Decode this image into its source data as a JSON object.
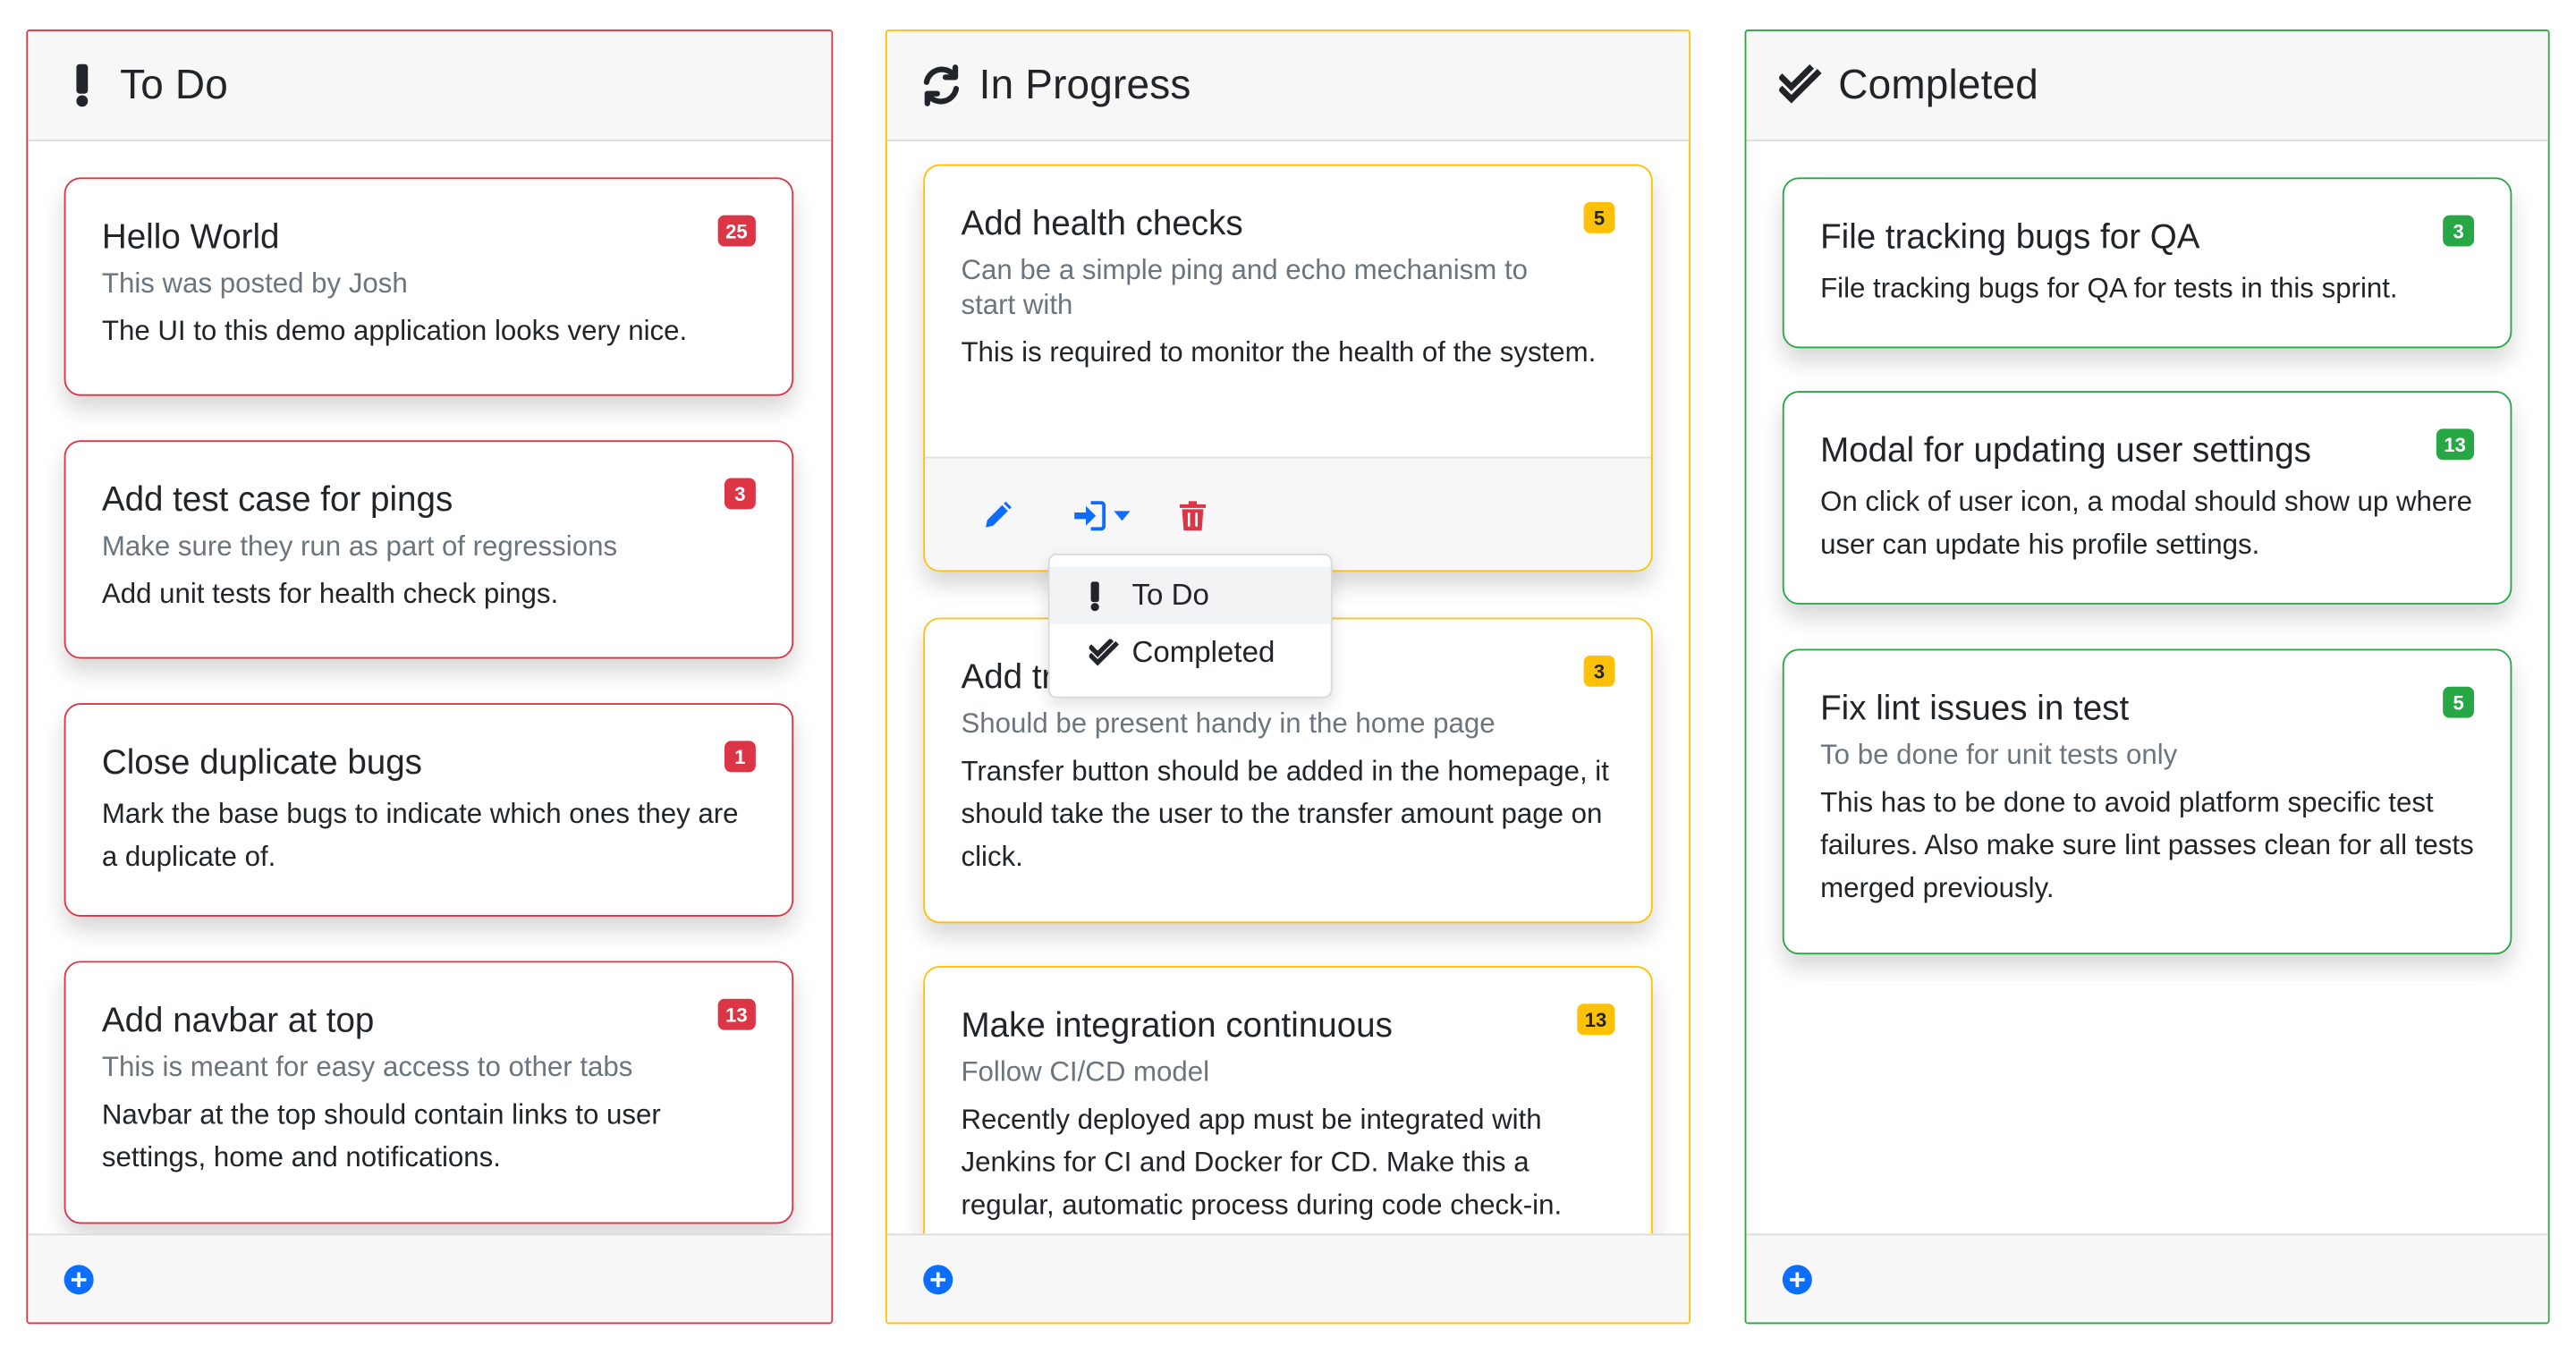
{
  "colors": {
    "todo": "#dc3545",
    "in_progress": "#ffc107",
    "completed": "#28a745",
    "primary": "#0d6efd"
  },
  "columns": [
    {
      "title": "To Do",
      "icon": "exclamation-icon",
      "add_icon": "plus-circle-icon",
      "cards": [
        {
          "title": "Hello World",
          "badge": "25",
          "subtitle": "This was posted by Josh",
          "text": "The UI to this demo application looks very nice."
        },
        {
          "title": "Add test case for pings",
          "badge": "3",
          "subtitle": "Make sure they run as part of regressions",
          "text": "Add unit tests for health check pings."
        },
        {
          "title": "Close duplicate bugs",
          "badge": "1",
          "subtitle": "",
          "text": "Mark the base bugs to indicate which ones they are a duplicate of."
        },
        {
          "title": "Add navbar at top",
          "badge": "13",
          "subtitle": "This is meant for easy access to other tabs",
          "text": "Navbar at the top should contain links to user settings, home and notifications."
        }
      ]
    },
    {
      "title": "In Progress",
      "icon": "sync-icon",
      "add_icon": "plus-circle-icon",
      "cards": [
        {
          "title": "Add health checks",
          "badge": "5",
          "subtitle": "Can be a simple ping and echo mechanism to start with",
          "text": "This is required to monitor the health of the system."
        },
        {
          "title": "Add tr",
          "badge": "3",
          "subtitle": "Should be present handy in the home page",
          "text": "Transfer button should be added in the homepage, it should take the user to the transfer amount page on click."
        },
        {
          "title": "Make integration continuous",
          "badge": "13",
          "subtitle": "Follow CI/CD model",
          "text": "Recently deployed app must be integrated with Jenkins for CI and Docker for CD. Make this a regular, automatic process during code check-in."
        }
      ],
      "card_tools": [
        "pencil-icon",
        "move-icon",
        "caret-down-icon",
        "trash-icon"
      ],
      "move_menu": [
        {
          "label": "To Do",
          "icon": "exclamation-icon"
        },
        {
          "label": "Completed",
          "icon": "double-check-icon"
        }
      ]
    },
    {
      "title": "Completed",
      "icon": "double-check-icon",
      "add_icon": "plus-circle-icon",
      "cards": [
        {
          "title": "File tracking bugs for QA",
          "badge": "3",
          "subtitle": "",
          "text": "File tracking bugs for QA for tests in this sprint."
        },
        {
          "title": "Modal for updating user settings",
          "badge": "13",
          "subtitle": "",
          "text": "On click of user icon, a modal should show up where user can update his profile settings."
        },
        {
          "title": "Fix lint issues in test",
          "badge": "5",
          "subtitle": "To be done for unit tests only",
          "text": "This has to be done to avoid platform specific test failures. Also make sure lint passes clean for all tests merged previously."
        }
      ]
    }
  ]
}
